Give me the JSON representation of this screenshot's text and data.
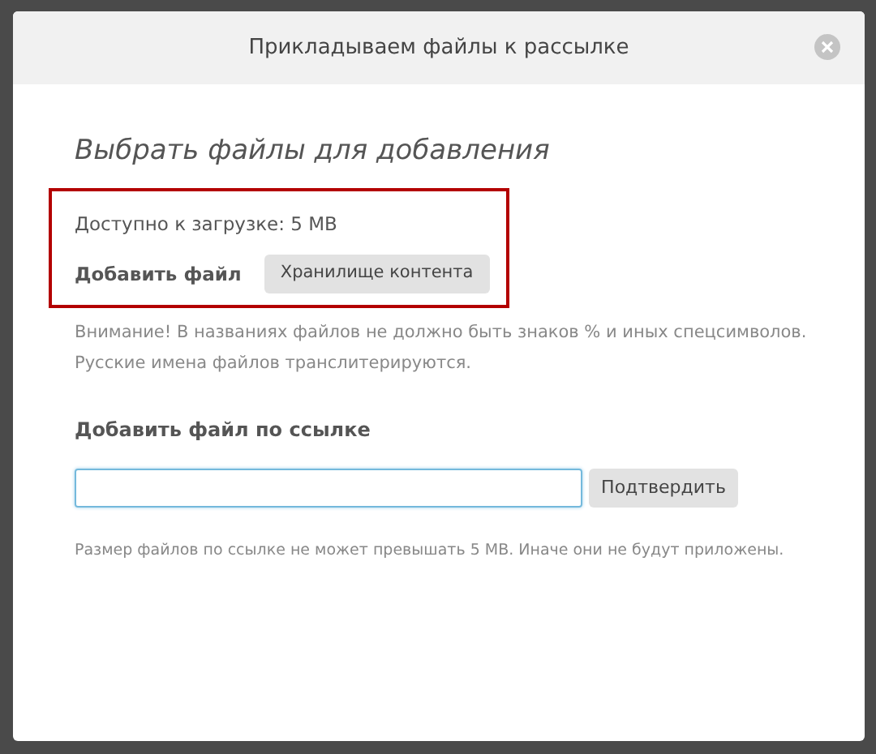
{
  "dialog": {
    "title": "Прикладываем файлы к рассылке"
  },
  "upload": {
    "heading": "Выбрать файлы для добавления",
    "highlighted": true,
    "available": "Доступно к загрузке: 5 MB",
    "add_label": "Добавить файл",
    "storage_button": "Хранилище контента",
    "warning": "Внимание! В названиях файлов не должно быть знаков % и иных спецсимволов. Русские имена файлов транслитерируются."
  },
  "link": {
    "heading": "Добавить файл по ссылке",
    "url_field": {
      "focused": true
    },
    "confirm_button": "Подтвердить",
    "note": "Размер файлов по ссылке не может превышать 5 MB. Иначе они не будут приложены."
  }
}
